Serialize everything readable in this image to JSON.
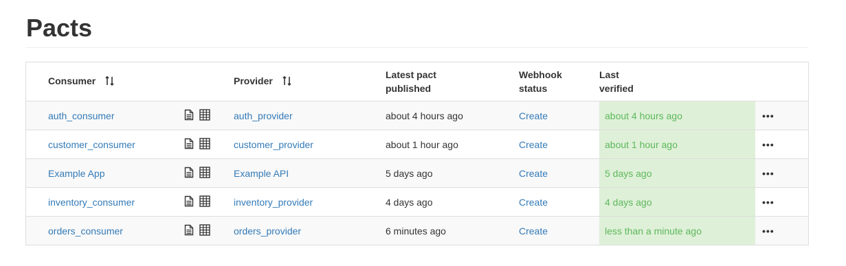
{
  "page": {
    "title": "Pacts"
  },
  "table": {
    "headers": {
      "consumer": "Consumer",
      "provider": "Provider",
      "latest_pact_line1": "Latest pact",
      "latest_pact_line2": "published",
      "webhook_line1": "Webhook",
      "webhook_line2": "status",
      "verified_line1": "Last",
      "verified_line2": "verified"
    },
    "rows": [
      {
        "consumer": "auth_consumer",
        "provider": "auth_provider",
        "published": "about 4 hours ago",
        "webhook": "Create",
        "verified": "about 4 hours ago",
        "actions": "•••"
      },
      {
        "consumer": "customer_consumer",
        "provider": "customer_provider",
        "published": "about 1 hour ago",
        "webhook": "Create",
        "verified": "about 1 hour ago",
        "actions": "•••"
      },
      {
        "consumer": "Example App",
        "provider": "Example API",
        "published": "5 days ago",
        "webhook": "Create",
        "verified": "5 days ago",
        "actions": "•••"
      },
      {
        "consumer": "inventory_consumer",
        "provider": "inventory_provider",
        "published": "4 days ago",
        "webhook": "Create",
        "verified": "4 days ago",
        "actions": "•••"
      },
      {
        "consumer": "orders_consumer",
        "provider": "orders_provider",
        "published": "6 minutes ago",
        "webhook": "Create",
        "verified": "less than a minute ago",
        "actions": "•••"
      }
    ]
  },
  "icons": {
    "sort": "sort-alt-icon",
    "document": "document-icon",
    "matrix": "matrix-grid-icon",
    "more": "more-dots-icon"
  },
  "colors": {
    "link": "#337ab7",
    "verified_bg": "#dff0d8",
    "verified_text": "#5cb85c"
  }
}
